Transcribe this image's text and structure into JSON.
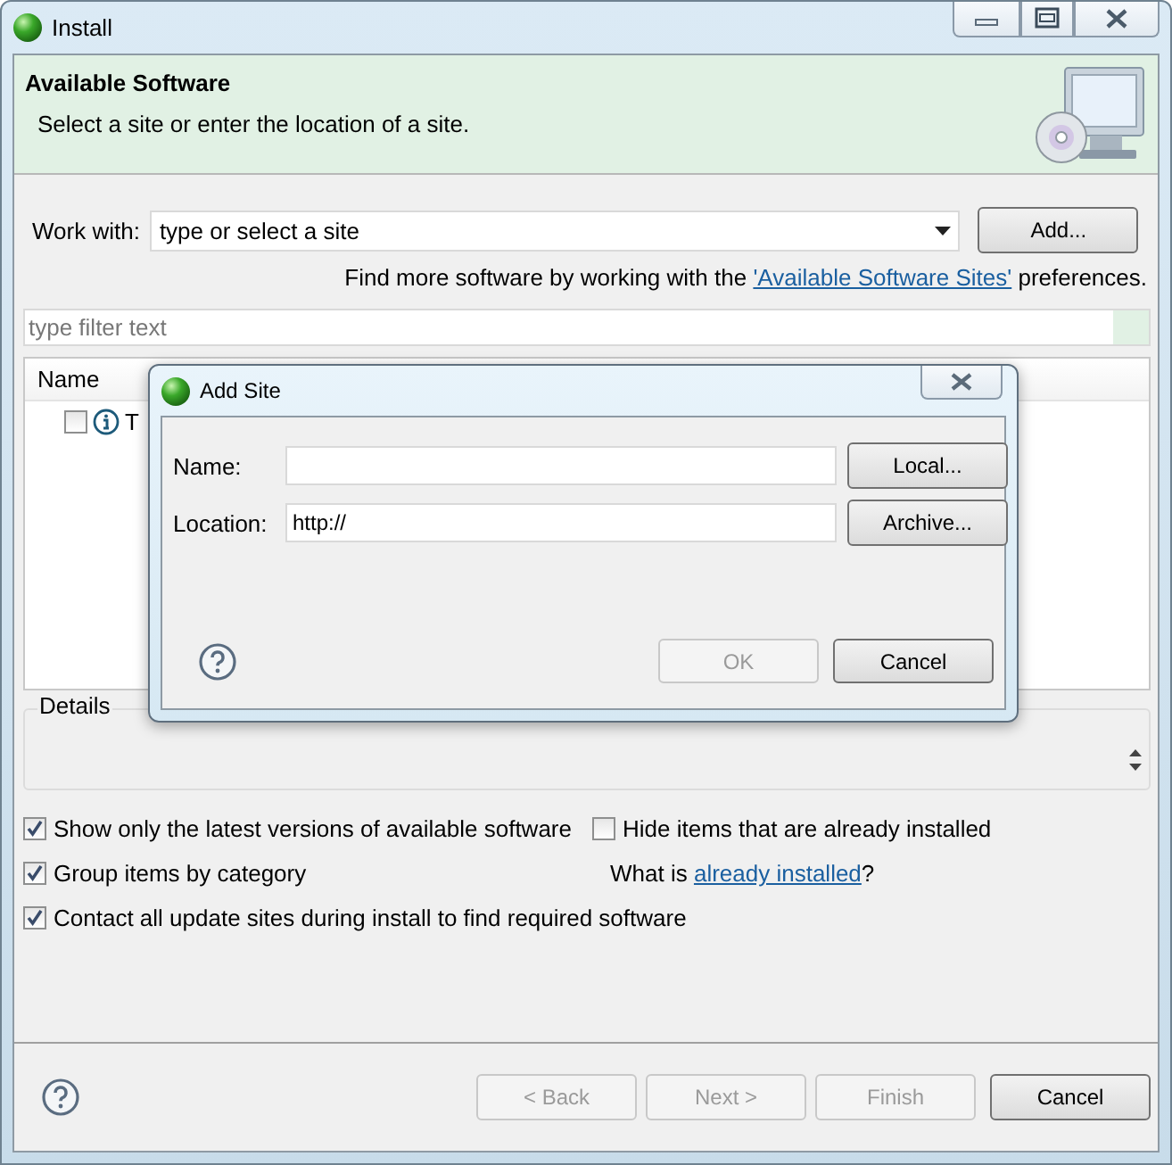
{
  "window": {
    "title": "Install"
  },
  "header": {
    "title": "Available Software",
    "subtitle": "Select a site or enter the location of a site."
  },
  "work_with": {
    "label": "Work with:",
    "placeholder": "type or select a site",
    "button": "Add..."
  },
  "sites_note": {
    "before": "Find more software by working with the ",
    "link": "'Available Software Sites'",
    "after": " preferences."
  },
  "filter": {
    "placeholder": "type filter text"
  },
  "table": {
    "columns": [
      "Name"
    ],
    "rows": [
      {
        "name": "T",
        "checked": false
      }
    ]
  },
  "details": {
    "label": "Details"
  },
  "options": [
    {
      "label": "Show only the latest versions of available software",
      "checked": true
    },
    {
      "label": "Hide items that are already installed",
      "checked": false
    },
    {
      "label": "Group items by category",
      "checked": true
    },
    {
      "label": "Contact all update sites during install to find required software",
      "checked": true
    }
  ],
  "installed_note": {
    "before": "What is ",
    "link": "already installed",
    "after": "?"
  },
  "buttons": [
    {
      "label": "< Back",
      "disabled": true
    },
    {
      "label": "Next >",
      "disabled": true
    },
    {
      "label": "Finish",
      "disabled": true
    },
    {
      "label": "Cancel",
      "disabled": false
    }
  ],
  "dialog": {
    "title": "Add Site",
    "fields": [
      {
        "label": "Name:",
        "button": "Local..."
      },
      {
        "label": "Location:",
        "value": "http://",
        "button": "Archive..."
      }
    ],
    "buttons": [
      {
        "label": "OK",
        "disabled": true
      },
      {
        "label": "Cancel",
        "disabled": false
      }
    ]
  }
}
